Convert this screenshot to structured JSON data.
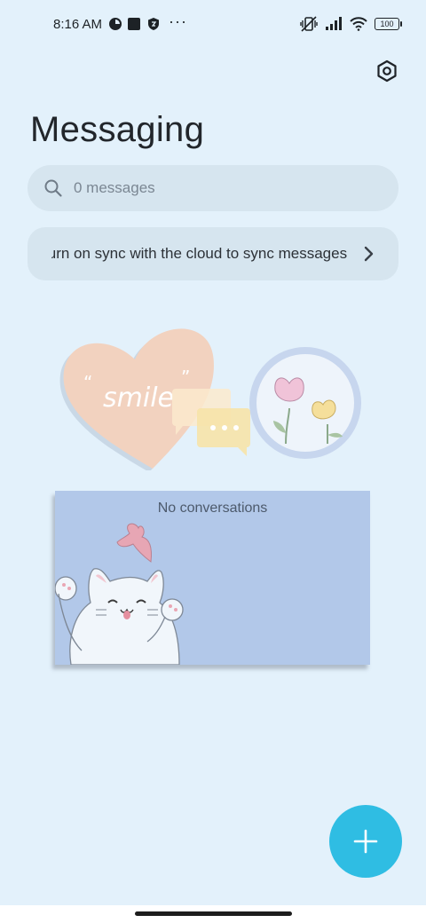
{
  "status_bar": {
    "time": "8:16 AM",
    "more": "···",
    "battery": "100"
  },
  "header": {
    "title": "Messaging",
    "settings_icon": "hexagon-settings-icon"
  },
  "search": {
    "placeholder": "0 messages",
    "icon": "search-icon"
  },
  "sync_banner": {
    "text": "Turn on sync with the cloud to sync messages",
    "chevron_icon": "chevron-right-icon"
  },
  "decoration": {
    "heart_word": "smile"
  },
  "empty_state": {
    "text": "No conversations"
  },
  "fab": {
    "icon": "plus-icon",
    "color": "#2fbde3"
  },
  "colors": {
    "background": "#e3f1fb",
    "pill": "#d6e5ef",
    "card": "#b2c8e9"
  }
}
